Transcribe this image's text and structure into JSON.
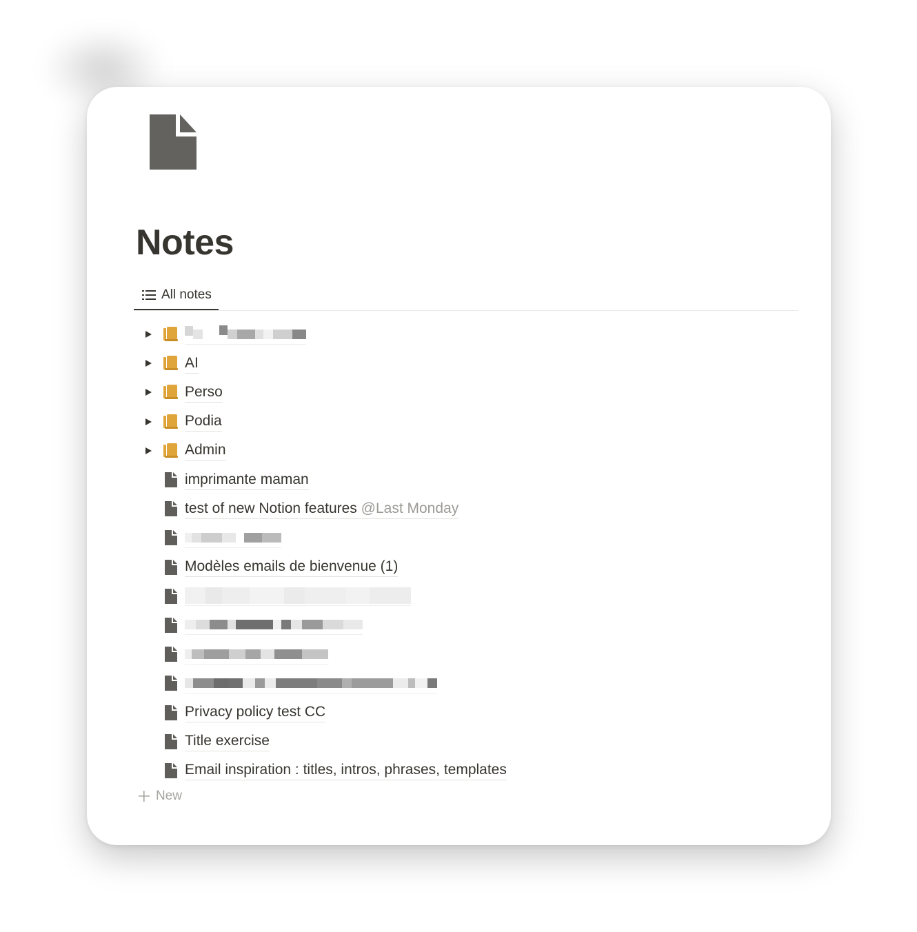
{
  "page": {
    "title": "Notes",
    "icon": "document-icon"
  },
  "tabs": [
    {
      "label": "All notes",
      "icon": "list-icon",
      "active": true
    }
  ],
  "items": [
    {
      "type": "folder",
      "title": "",
      "redacted": true,
      "expandable": true,
      "icon": "folder-book-icon"
    },
    {
      "type": "folder",
      "title": "AI",
      "expandable": true,
      "icon": "folder-book-icon"
    },
    {
      "type": "folder",
      "title": "Perso",
      "expandable": true,
      "icon": "folder-book-icon"
    },
    {
      "type": "folder",
      "title": "Podia",
      "expandable": true,
      "icon": "folder-book-icon"
    },
    {
      "type": "folder",
      "title": "Admin",
      "expandable": true,
      "icon": "folder-book-icon"
    },
    {
      "type": "page",
      "title": "imprimante maman",
      "icon": "page-icon"
    },
    {
      "type": "page",
      "title": "test of new Notion features",
      "mention": "@Last Monday",
      "icon": "page-icon"
    },
    {
      "type": "page",
      "title": "",
      "redacted": true,
      "icon": "page-icon"
    },
    {
      "type": "page",
      "title": "Modèles emails de bienvenue (1)",
      "icon": "page-icon"
    },
    {
      "type": "page",
      "title": "",
      "redacted": true,
      "icon": "page-icon"
    },
    {
      "type": "page",
      "title": "",
      "redacted": true,
      "icon": "page-icon"
    },
    {
      "type": "page",
      "title": "",
      "redacted": true,
      "icon": "page-icon"
    },
    {
      "type": "page",
      "title": "",
      "redacted": true,
      "icon": "page-icon"
    },
    {
      "type": "page",
      "title": "Privacy policy test CC",
      "icon": "page-icon"
    },
    {
      "type": "page",
      "title": "Title exercise",
      "icon": "page-icon"
    },
    {
      "type": "page",
      "title": "Email inspiration : titles, intros, phrases, templates",
      "icon": "page-icon"
    }
  ],
  "new_button": {
    "label": "New",
    "icon": "plus-icon"
  },
  "colors": {
    "text": "#37352f",
    "muted": "#9b9a97",
    "folder": "#e0a53a",
    "icon": "#5f5e5b"
  }
}
